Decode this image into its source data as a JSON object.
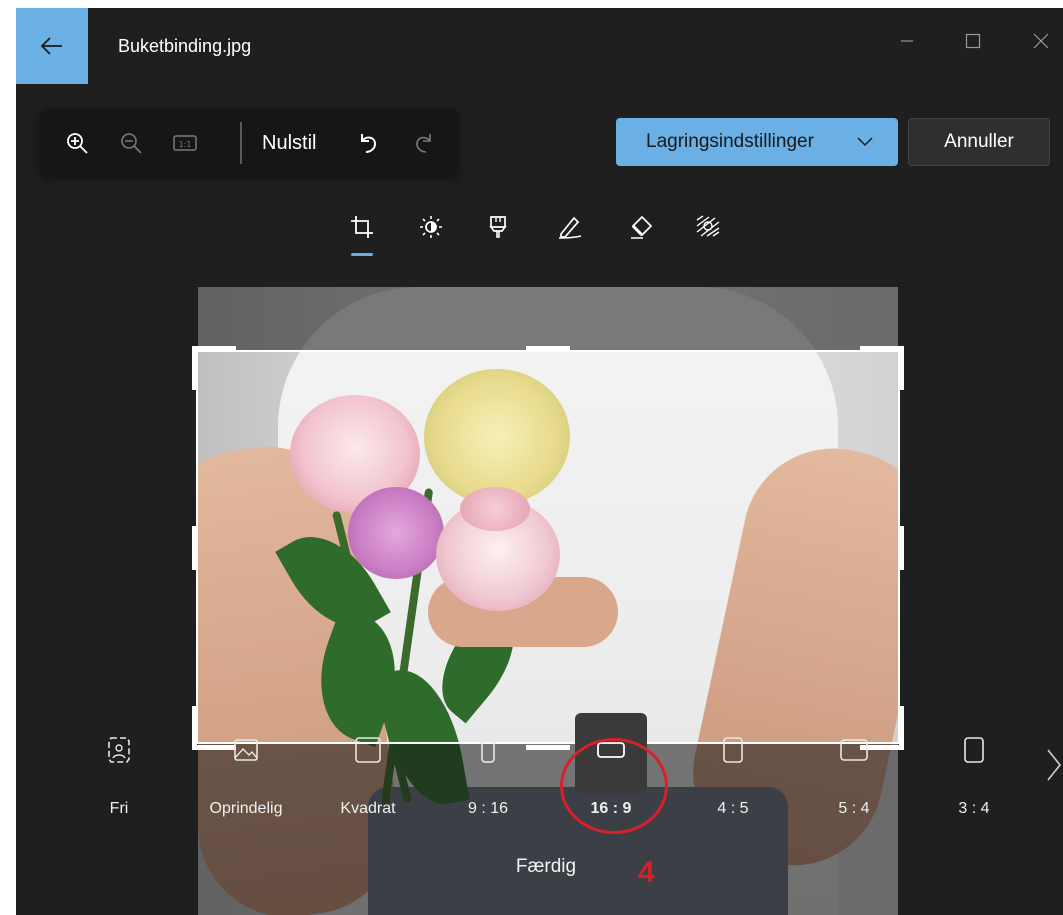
{
  "window": {
    "title": "Buketbinding.jpg",
    "back_icon": "arrow-left-icon",
    "controls": [
      "minimize-icon",
      "maximize-icon",
      "close-icon"
    ]
  },
  "toolbar": {
    "icons": [
      "zoom-in-icon",
      "zoom-out-icon",
      "actual-size-icon",
      "undo-icon",
      "redo-icon"
    ],
    "reset_label": "Nulstil"
  },
  "actions": {
    "save_label": "Lagringsindstillinger",
    "cancel_label": "Annuller"
  },
  "tools": {
    "items": [
      "crop-icon",
      "adjust-brightness-icon",
      "filter-icon",
      "markup-icon",
      "erase-icon",
      "background-blur-icon"
    ],
    "active": "crop-icon"
  },
  "aspect_ratios": {
    "items": [
      {
        "label": "Fri",
        "icon": "free-crop-icon"
      },
      {
        "label": "Oprindelig",
        "icon": "original-image-icon"
      },
      {
        "label": "Kvadrat",
        "icon": "square-icon"
      },
      {
        "label": "9 : 16",
        "icon": "portrait-9-16-icon"
      },
      {
        "label": "16 : 9",
        "icon": "landscape-16-9-icon"
      },
      {
        "label": "4 : 5",
        "icon": "portrait-4-5-icon"
      },
      {
        "label": "5 : 4",
        "icon": "landscape-5-4-icon"
      },
      {
        "label": "3 : 4",
        "icon": "portrait-3-4-icon"
      }
    ],
    "selected": "16 : 9"
  },
  "done_label": "Færdig",
  "annotation": {
    "number": "4",
    "color": "#d8202a"
  },
  "colors": {
    "accent": "#6ab0e4",
    "background": "#1f1f1f"
  }
}
